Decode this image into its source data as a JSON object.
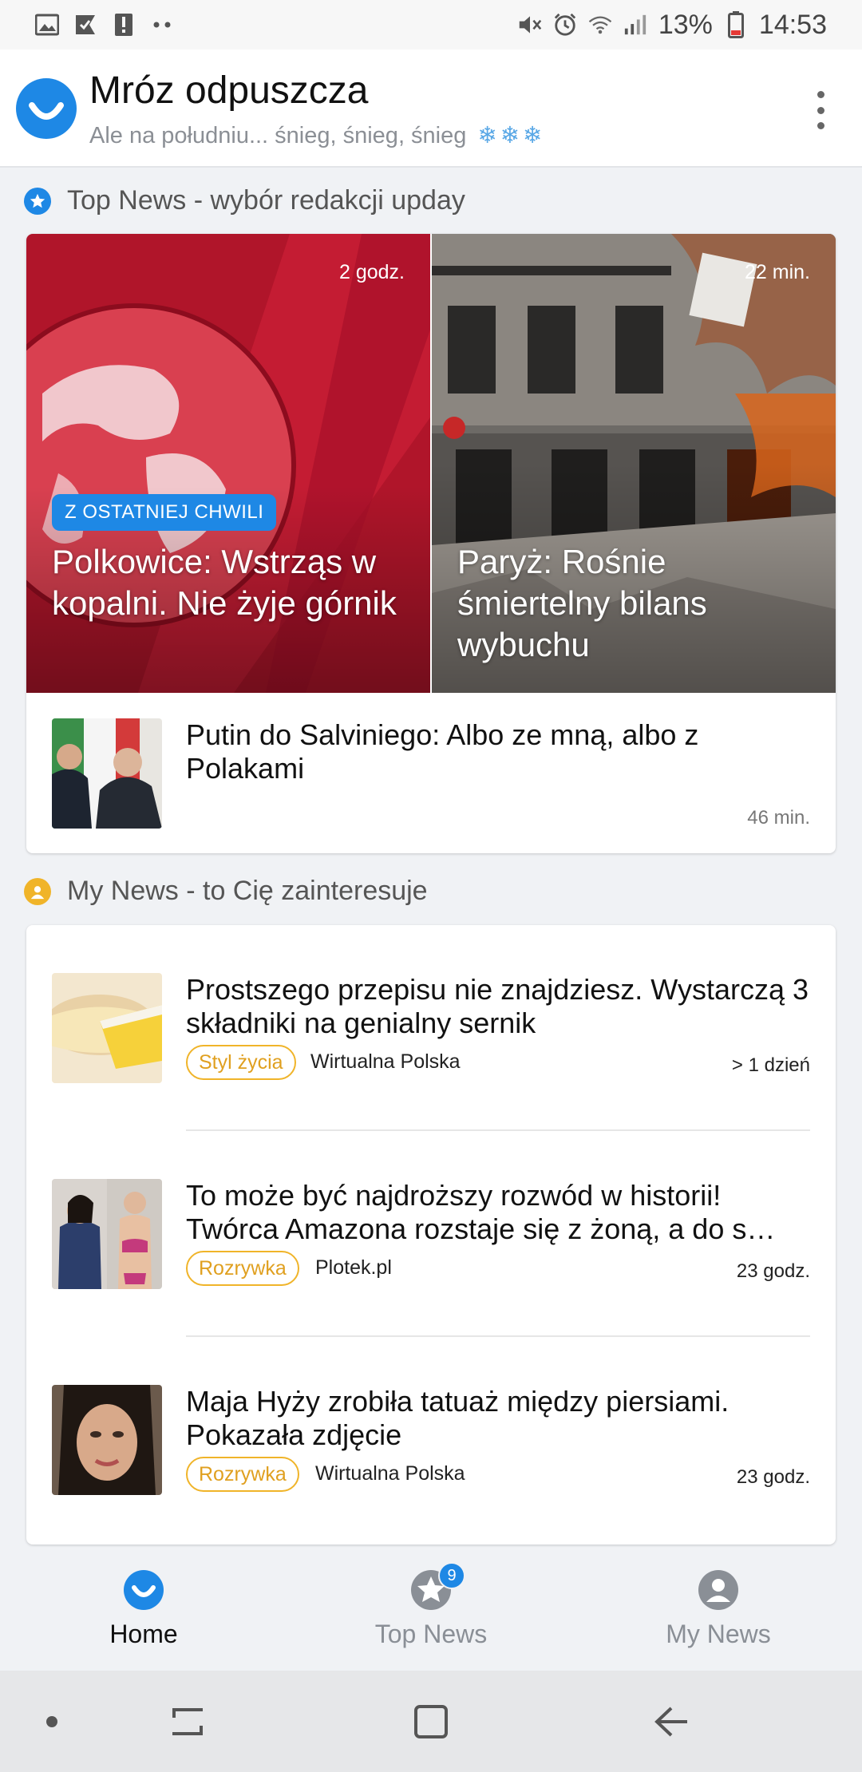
{
  "status_bar": {
    "battery": "13%",
    "time": "14:53",
    "icons": [
      "image-icon",
      "check-flag-icon",
      "alert-icon",
      "more-dots-icon",
      "mute-icon",
      "alarm-icon",
      "wifi-icon",
      "signal-icon",
      "battery-icon"
    ]
  },
  "header": {
    "title": "Mróz odpuszcza",
    "subtitle": "Ale na południu... śnieg, śnieg, śnieg",
    "snowflakes": "❄❄❄"
  },
  "top_news": {
    "section_label": "Top News - wybór redakcji upday",
    "tiles": [
      {
        "time": "2 godz.",
        "badge": "Z OSTATNIEJ CHWILI",
        "title": "Polkowice: Wstrząs w kopalni. Nie żyje górnik"
      },
      {
        "time": "22 min.",
        "title": "Paryż: Rośnie śmiertelny bilans wybuchu"
      }
    ],
    "row": {
      "title": "Putin do Salviniego: Albo ze mną, albo z Polakami",
      "time": "46 min."
    }
  },
  "my_news": {
    "section_label": "My News - to Cię zainteresuje",
    "items": [
      {
        "title": "Prostszego przepisu nie znajdziesz. Wystarczą 3 składniki na genialny sernik",
        "tag": "Styl życia",
        "source": "Wirtualna Polska",
        "time": "> 1 dzień"
      },
      {
        "title": "To może być najdroższy rozwód w historii! Twórca Amazona rozstaje się z żoną, a do s…",
        "tag": "Rozrywka",
        "source": "Plotek.pl",
        "time": "23 godz."
      },
      {
        "title": "Maja Hyży zrobiła tatuaż między piersiami. Pokazała zdjęcie",
        "tag": "Rozrywka",
        "source": "Wirtualna Polska",
        "time": "23 godz."
      }
    ]
  },
  "bottom_nav": {
    "items": [
      {
        "label": "Home",
        "active": true
      },
      {
        "label": "Top News",
        "badge": "9"
      },
      {
        "label": "My News"
      }
    ]
  },
  "colors": {
    "accent": "#1e88e5",
    "tag": "#f0b429",
    "my_news_icon": "#f0b429"
  }
}
